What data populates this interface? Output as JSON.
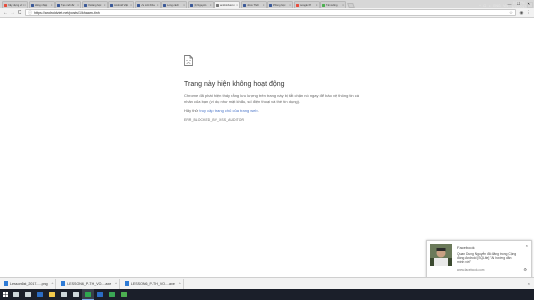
{
  "tabs": [
    {
      "title": "Xây dựng ví t",
      "color": "#e74c3c",
      "active": false
    },
    {
      "title": "Đăng nhập",
      "color": "#3b5998",
      "active": false
    },
    {
      "title": "Tạo mới đư",
      "color": "#3b5998",
      "active": false
    },
    {
      "title": "Khoảng học",
      "color": "#3b5998",
      "active": false
    },
    {
      "title": "Android Việt",
      "color": "#3b5998",
      "active": false
    },
    {
      "title": "Ưu mới Kha",
      "color": "#3b5998",
      "active": false
    },
    {
      "title": "Long cách",
      "color": "#3b5998",
      "active": false
    },
    {
      "title": "(4) Nguyễn",
      "color": "#3b5998",
      "active": false
    },
    {
      "title": "androidviet.n",
      "color": "#777777",
      "active": true
    },
    {
      "title": "Inbox Thời",
      "color": "#3b5998",
      "active": false
    },
    {
      "title": "Phòng học",
      "color": "#3b5998",
      "active": false
    },
    {
      "title": "Google Pl",
      "color": "#e74c3c",
      "active": false
    },
    {
      "title": "Tải xuống",
      "color": "#4caf50",
      "active": false
    }
  ],
  "window": {
    "minimize": "—",
    "maximize": "☐",
    "close": "✕"
  },
  "toolbar": {
    "back": "←",
    "forward": "→",
    "reload": "C",
    "url": "https://androidviet.net/posts/1/khaam-tinh",
    "info_icon": "ⓘ",
    "star": "☆",
    "ext_icon": "◉",
    "menu_icon": "⋮"
  },
  "error": {
    "title": "Trang này hiện không hoạt động",
    "description": "Chrome đã phát hiện thấy rằng lưu lượng trên trang này bị tắt chặn nó ngay để bảo vệ thông tin cá nhân của bạn (ví dụ như mật khẩu, số điện thoại và thẻ tín dụng).",
    "try_prefix": "Hãy thử ",
    "try_link": "truy cập trang chủ của trang web",
    "try_suffix": ".",
    "code": "ERR_BLOCKED_BY_XSS_AUDITOR"
  },
  "notification": {
    "app": "Facebook",
    "close": "×",
    "message": "Quan Dung Nguyễn đã đăng trong Cộng đồng Android [SQLite] \"Ai hướng dẫn mình với\"",
    "source": "www.facebook.com",
    "gear": "⚙",
    "footer": "Notification Settings",
    "footer_icon": "⚙"
  },
  "downloads": [
    {
      "name": "Lesson6st_2017-....png",
      "caret": "^",
      "color": "#2e7bd6"
    },
    {
      "name": "LESSON6_P-TH_VO....axe",
      "caret": "^",
      "color": "#2e7bd6"
    },
    {
      "name": "LESSON6_P-TH_VO....axe",
      "caret": "^",
      "color": "#2e7bd6"
    }
  ],
  "download_close": "×",
  "taskbar": {
    "apps": [
      {
        "color": "#cfd8dc",
        "active": false
      },
      {
        "color": "#cfd8dc",
        "active": false
      },
      {
        "color": "#2b6cc4",
        "active": false
      },
      {
        "color": "#f2c94c",
        "active": false
      },
      {
        "color": "#cfd8dc",
        "active": false
      },
      {
        "color": "#cfd8dc",
        "active": false
      },
      {
        "color": "#2fa84f",
        "active": true
      },
      {
        "color": "#2b6cc4",
        "active": false
      },
      {
        "color": "#3aa655",
        "active": false
      },
      {
        "color": "#4caf50",
        "active": false
      }
    ],
    "tray": [
      "^",
      "⊡",
      "◖",
      "ENG",
      "VN"
    ],
    "time": "8:55 PM",
    "date": "6/15/2017"
  }
}
